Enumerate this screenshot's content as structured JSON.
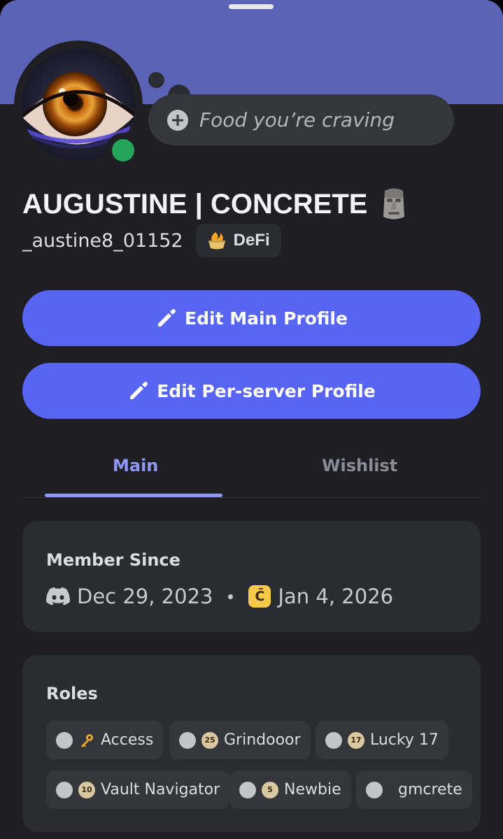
{
  "status_bubble": {
    "icon": "plus-circle-icon",
    "placeholder": "Food you’re craving"
  },
  "profile": {
    "display_name": "AUGUSTINE | CONCRETE",
    "display_name_emoji": "moai-icon",
    "username": "_austine8_01152",
    "tag": {
      "icon": "flame-pot-icon",
      "label": "DeFi"
    },
    "presence": "online",
    "colors": {
      "banner": "#5b63b6",
      "online": "#23a55a",
      "accent": "#5865f2"
    }
  },
  "actions": {
    "edit_main": "Edit Main Profile",
    "edit_server": "Edit Per-server Profile"
  },
  "tabs": {
    "main": "Main",
    "wishlist": "Wishlist",
    "active": "Main"
  },
  "member_since": {
    "title": "Member Since",
    "discord_date": "Dec 29, 2023",
    "server_icon_letter": "C̄",
    "server_date": "Jan 4, 2026"
  },
  "roles": {
    "title": "Roles",
    "items": [
      {
        "label": "Access",
        "emoji": "key-icon"
      },
      {
        "label": "Grindooor",
        "emoji": "badge-25-icon",
        "badge": "25"
      },
      {
        "label": "Lucky 17",
        "emoji": "badge-17-icon",
        "badge": "17"
      },
      {
        "label": "Vault Navigator",
        "emoji": "badge-10-icon",
        "badge": "10"
      },
      {
        "label": "Newbie",
        "emoji": "badge-5-icon",
        "badge": "5"
      },
      {
        "label": "gmcrete",
        "emoji": ""
      }
    ]
  }
}
